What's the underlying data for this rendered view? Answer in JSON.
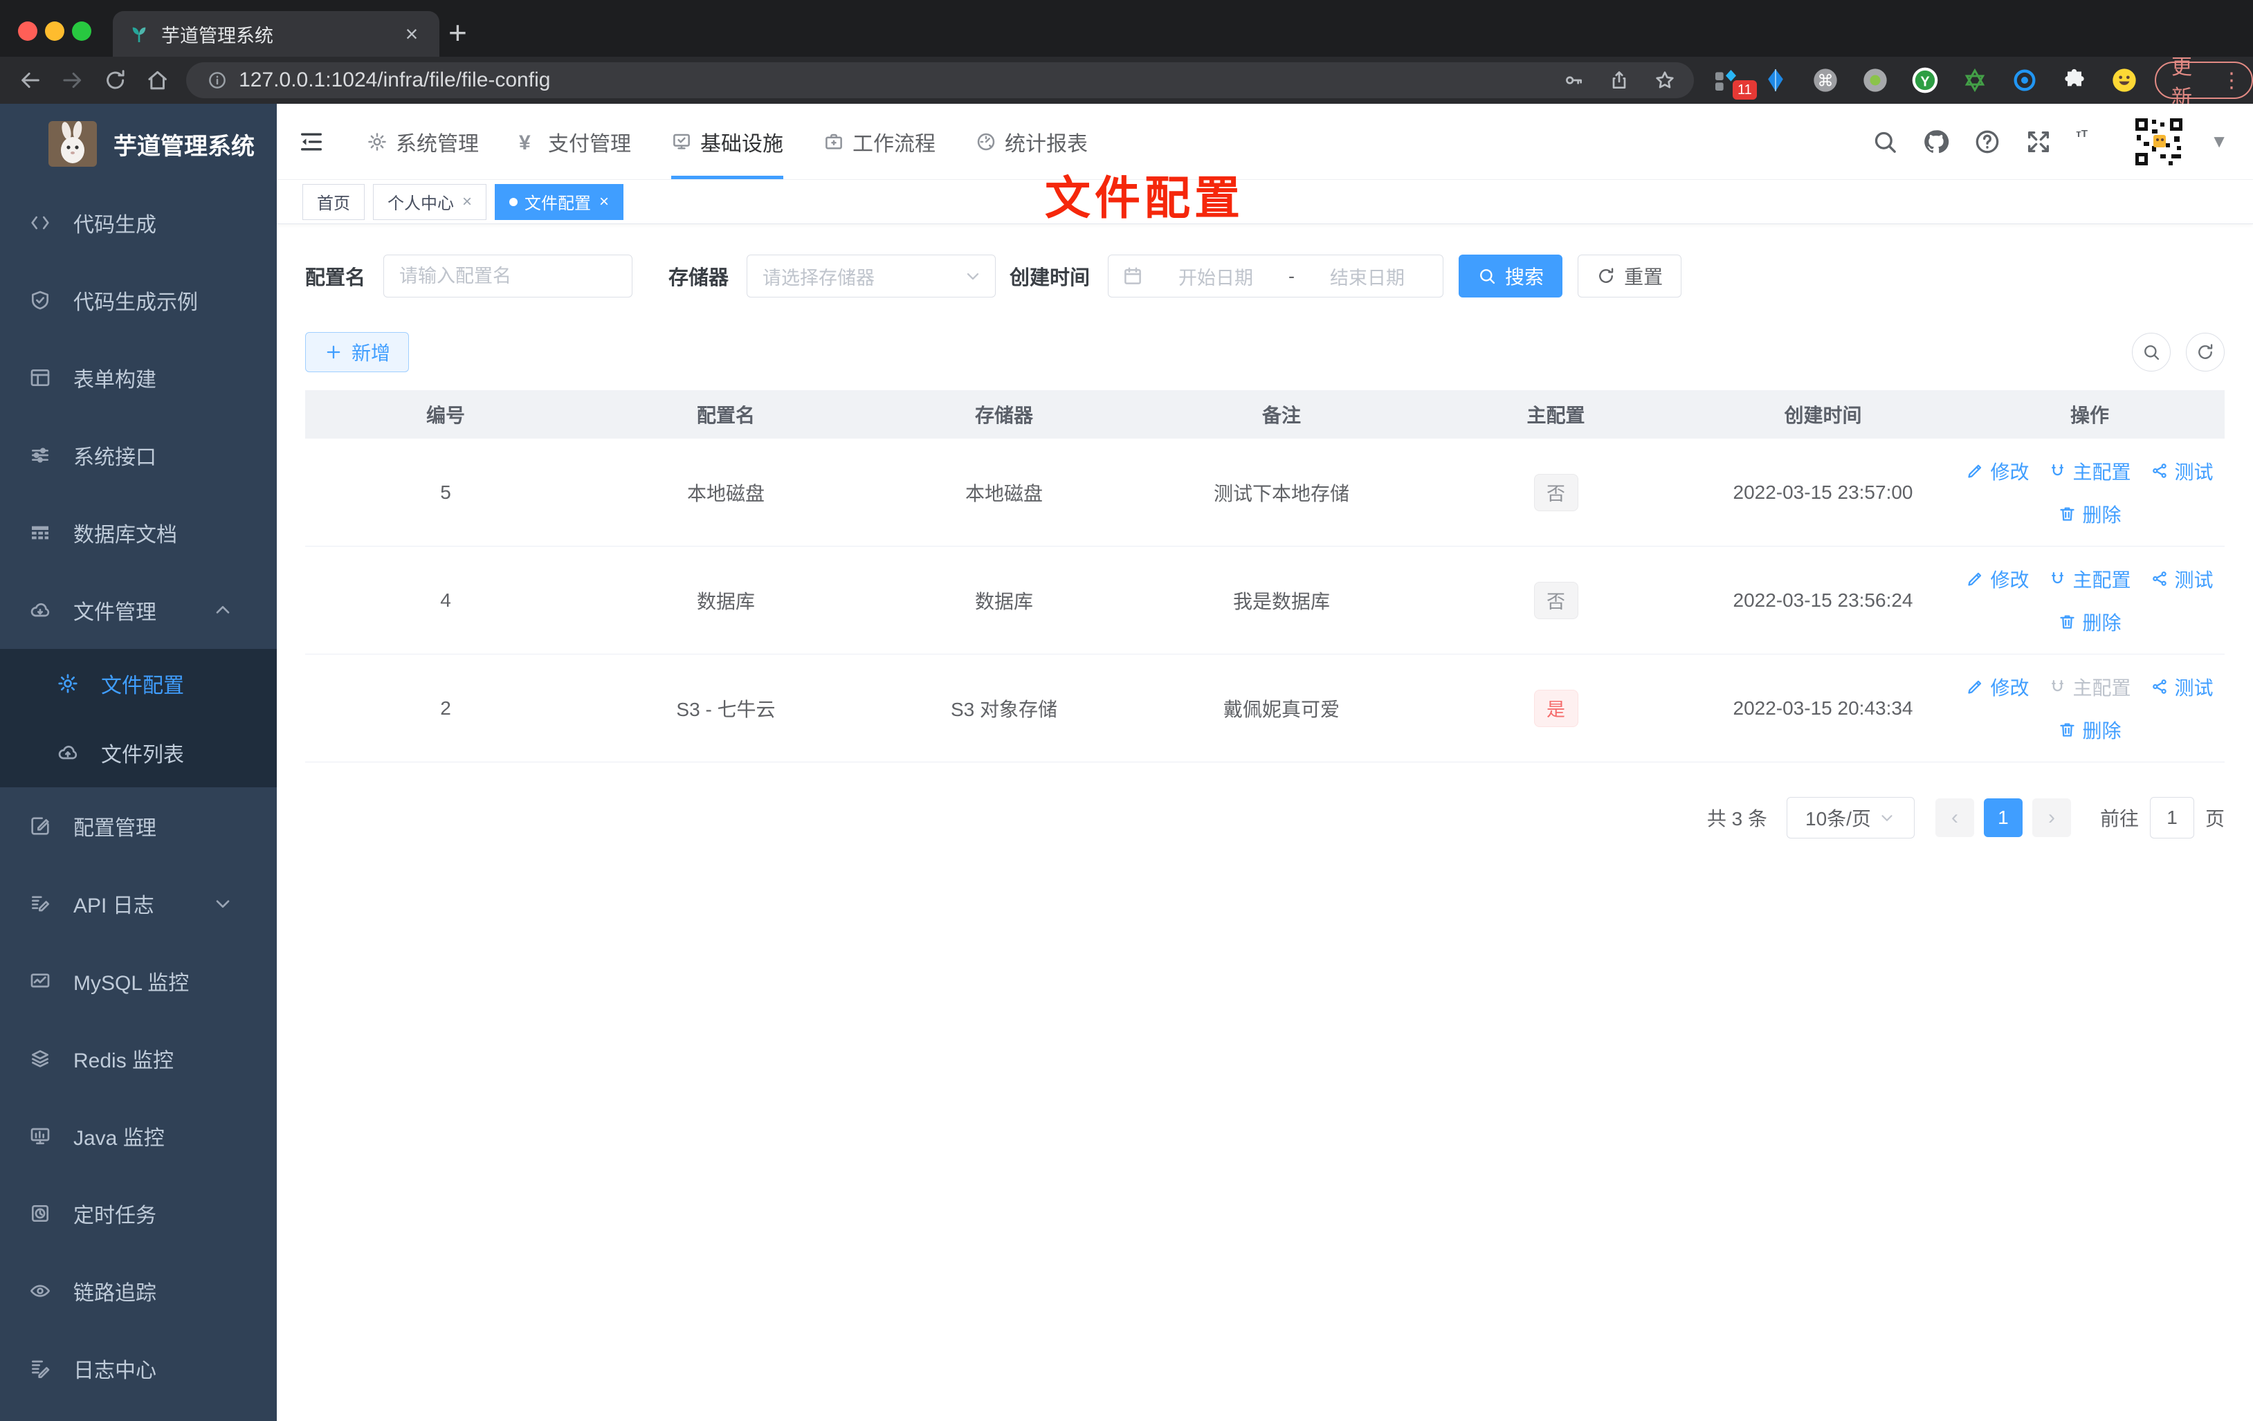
{
  "browser": {
    "tab_title": "芋道管理系统",
    "url": "127.0.0.1:1024/infra/file/file-config",
    "update_label": "更新",
    "extension_badge": "11",
    "pill_icons": [
      "key-icon",
      "share-up-icon",
      "star-icon"
    ],
    "extensions": [
      "grid-badge-icon",
      "kite-icon",
      "command-circle-icon",
      "dot-circle-icon",
      "y-circle-icon",
      "star-outline-icon",
      "eye-ring-icon",
      "puzzle-icon",
      "emoji-icon"
    ]
  },
  "header": {
    "nav": [
      {
        "icon": "gear-icon",
        "label": "系统管理"
      },
      {
        "icon": "yen-icon",
        "label": "支付管理"
      },
      {
        "icon": "infra-icon",
        "label": "基础设施",
        "active": true
      },
      {
        "icon": "briefcase-icon",
        "label": "工作流程"
      },
      {
        "icon": "report-icon",
        "label": "统计报表"
      }
    ],
    "tools": [
      "search-icon",
      "github-icon",
      "help-icon",
      "fullscreen-icon",
      "font-size-icon"
    ]
  },
  "sidebar": {
    "title": "芋道管理系统",
    "items": [
      {
        "icon": "code-icon",
        "label": "代码生成"
      },
      {
        "icon": "shield-check-icon",
        "label": "代码生成示例"
      },
      {
        "icon": "form-icon",
        "label": "表单构建"
      },
      {
        "icon": "sliders-icon",
        "label": "系统接口"
      },
      {
        "icon": "table-grid-icon",
        "label": "数据库文档"
      },
      {
        "icon": "cloud-download-icon",
        "label": "文件管理",
        "arrow_icon": "chevron-up-icon"
      },
      {
        "icon": "gear-icon",
        "label": "文件配置",
        "sub": true,
        "active": true
      },
      {
        "icon": "cloud-upload-icon",
        "label": "文件列表",
        "sub": true
      },
      {
        "icon": "edit-square-icon",
        "label": "配置管理"
      },
      {
        "icon": "doc-edit-icon",
        "label": "API 日志",
        "arrow_icon": "chevron-down-icon"
      },
      {
        "icon": "chart-monitor-icon",
        "label": "MySQL 监控"
      },
      {
        "icon": "layers-icon",
        "label": "Redis 监控"
      },
      {
        "icon": "java-monitor-icon",
        "label": "Java 监控"
      },
      {
        "icon": "timer-task-icon",
        "label": "定时任务"
      },
      {
        "icon": "eye-icon",
        "label": "链路追踪"
      },
      {
        "icon": "log-edit-icon",
        "label": "日志中心"
      }
    ]
  },
  "tags": [
    {
      "label": "首页"
    },
    {
      "label": "个人中心",
      "closable": true
    },
    {
      "label": "文件配置",
      "active": true,
      "dot": true,
      "closable": true
    }
  ],
  "annotation": "文件配置",
  "filters": {
    "name_label": "配置名",
    "name_placeholder": "请输入配置名",
    "storage_label": "存储器",
    "storage_placeholder": "请选择存储器",
    "time_label": "创建时间",
    "start_placeholder": "开始日期",
    "range_separator": "-",
    "end_placeholder": "结束日期",
    "search_label": "搜索",
    "reset_label": "重置"
  },
  "toolbar": {
    "add_label": "新增"
  },
  "table": {
    "columns": [
      "编号",
      "配置名",
      "存储器",
      "备注",
      "主配置",
      "创建时间",
      "操作"
    ],
    "action_labels": {
      "edit": "修改",
      "master": "主配置",
      "test": "测试",
      "delete": "删除"
    },
    "rows": [
      {
        "id": "5",
        "name": "本地磁盘",
        "storage": "本地磁盘",
        "remark": "测试下本地存储",
        "master": "否",
        "master_danger": false,
        "master_action_disabled": false,
        "created": "2022-03-15 23:57:00"
      },
      {
        "id": "4",
        "name": "数据库",
        "storage": "数据库",
        "remark": "我是数据库",
        "master": "否",
        "master_danger": false,
        "master_action_disabled": false,
        "created": "2022-03-15 23:56:24"
      },
      {
        "id": "2",
        "name": "S3 - 七牛云",
        "storage": "S3 对象存储",
        "remark": "戴佩妮真可爱",
        "master": "是",
        "master_danger": true,
        "master_action_disabled": true,
        "created": "2022-03-15 20:43:34"
      }
    ]
  },
  "pagination": {
    "total": "共 3 条",
    "page_size": "10条/页",
    "page": "1",
    "goto_label": "前往",
    "goto_value": "1",
    "unit": "页"
  },
  "colors": {
    "accent": "#409eff",
    "danger": "#f56c6c",
    "sidebar_bg": "#304156",
    "annotation_red": "#f5270b"
  }
}
